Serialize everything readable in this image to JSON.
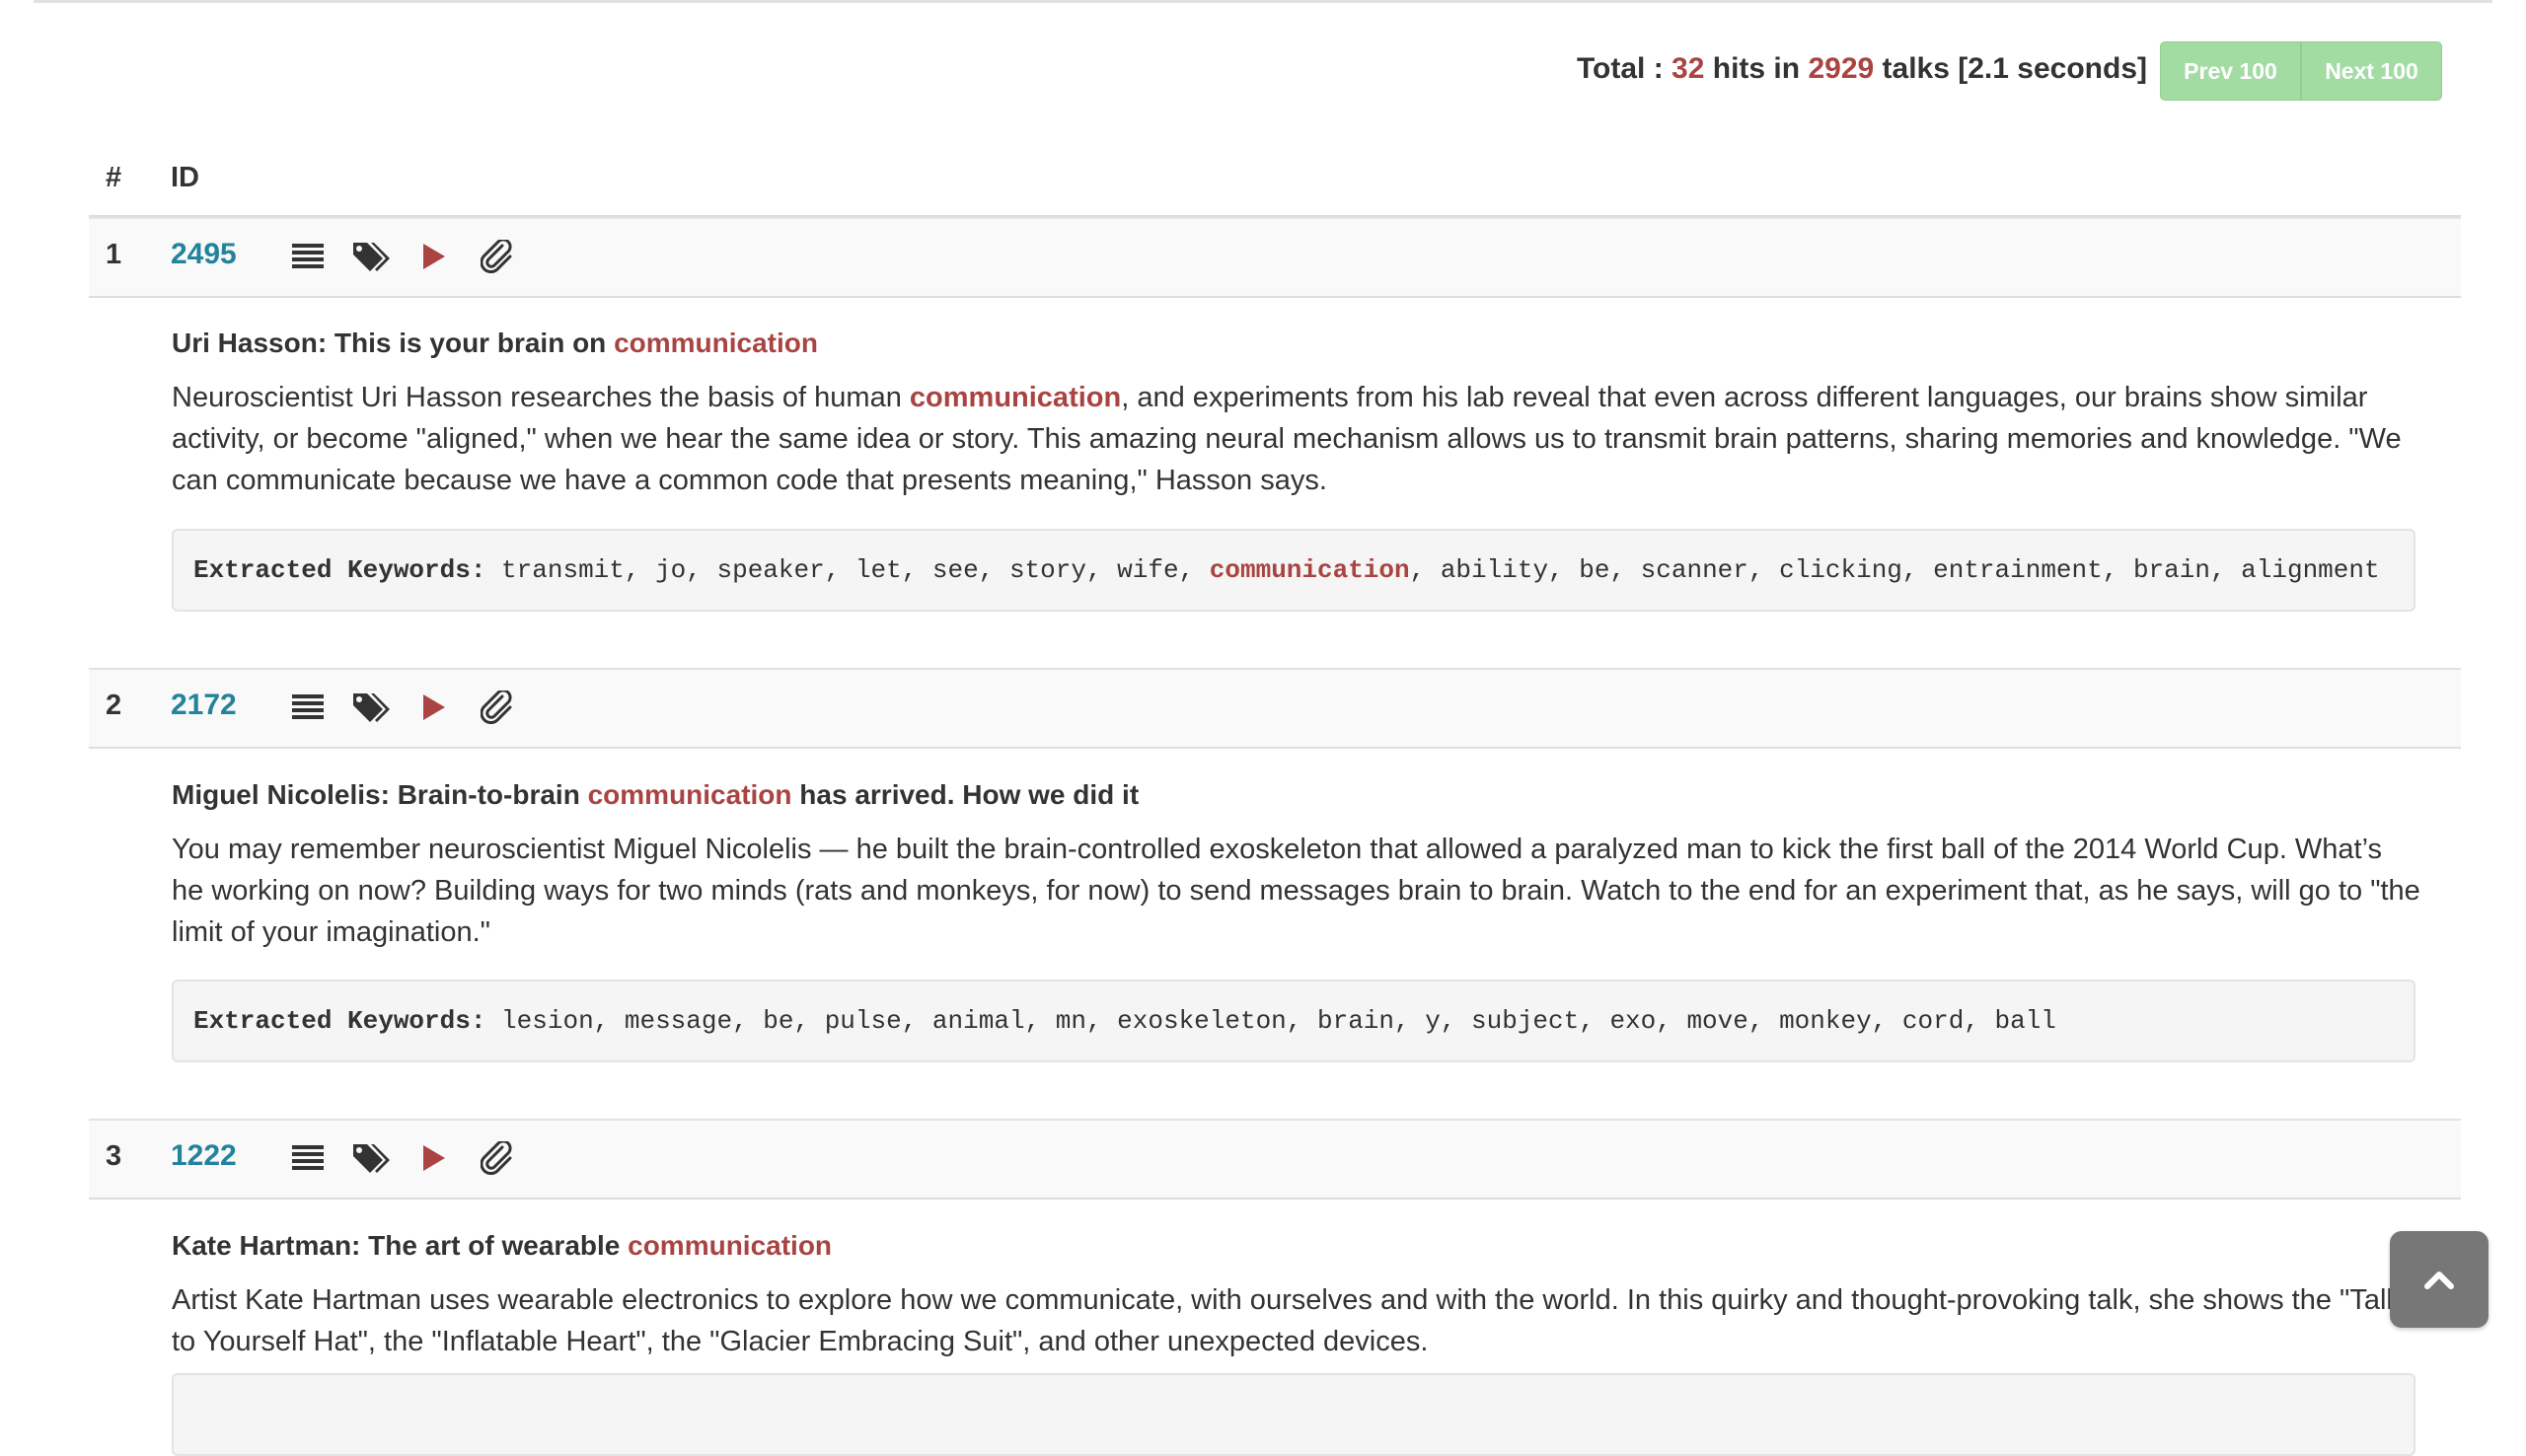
{
  "summary": {
    "total_label": "Total :",
    "hits": "32",
    "hits_label": "hits in",
    "talks": "2929",
    "talks_label": "talks [2.1 seconds]"
  },
  "pager": {
    "prev": "Prev 100",
    "next": "Next 100"
  },
  "table": {
    "col_num": "#",
    "col_id": "ID"
  },
  "highlight_color": "#a94442",
  "link_color": "#23839c",
  "icons": [
    "list-icon",
    "tags-icon",
    "play-icon",
    "paperclip-icon"
  ],
  "results": [
    {
      "num": "1",
      "id": "2495",
      "title_pre": "Uri Hasson: This is your brain on ",
      "title_hl": "communication",
      "title_post": "",
      "desc_pre": "Neuroscientist Uri Hasson researches the basis of human ",
      "desc_hl": "communication",
      "desc_post": ", and experiments from his lab reveal that even across different languages, our brains show similar activity, or become \"aligned,\" when we hear the same idea or story. This amazing neural mechanism allows us to transmit brain patterns, sharing memories and knowledge. \"We can communicate because we have a common code that presents meaning,\" Hasson says.",
      "kw_label": "Extracted Keywords:",
      "kw_pre": " transmit, jo, speaker, let, see, story, wife, ",
      "kw_hl": "communication",
      "kw_post": ", ability, be, scanner, clicking, entrainment, brain, alignment"
    },
    {
      "num": "2",
      "id": "2172",
      "title_pre": "Miguel Nicolelis: Brain-to-brain ",
      "title_hl": "communication",
      "title_post": " has arrived. How we did it",
      "desc_pre": "You may remember neuroscientist Miguel Nicolelis — he built the brain-controlled exoskeleton that allowed a paralyzed man to kick the first ball of the 2014 World Cup. What’s he working on now? Building ways for two minds (rats and monkeys, for now) to send messages brain to brain. Watch to the end for an experiment that, as he says, will go to \"the limit of your imagination.\"",
      "desc_hl": "",
      "desc_post": "",
      "kw_label": "Extracted Keywords:",
      "kw_pre": " lesion, message, be, pulse, animal, mn, exoskeleton, brain, y, subject, exo, move, monkey, cord, ball",
      "kw_hl": "",
      "kw_post": ""
    },
    {
      "num": "3",
      "id": "1222",
      "title_pre": "Kate Hartman: The art of wearable ",
      "title_hl": "communication",
      "title_post": "",
      "desc_pre": "Artist Kate Hartman uses wearable electronics to explore how we communicate, with ourselves and with the world. In this quirky and thought-provoking talk, she shows the \"Talk to Yourself Hat\", the \"Inflatable Heart\", the \"Glacier Embracing Suit\", and other unexpected devices.",
      "desc_hl": "",
      "desc_post": ""
    }
  ],
  "back_to_top_icon": "chevron-up-icon"
}
